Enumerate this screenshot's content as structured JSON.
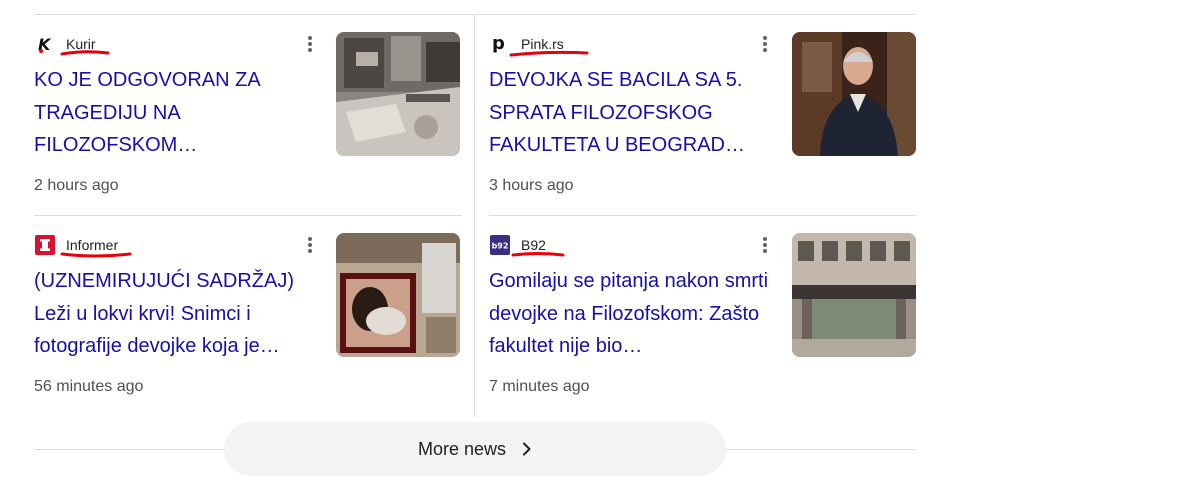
{
  "articles": [
    {
      "source": "Kurir",
      "favicon": "kurir-logo-icon",
      "headline": "KO JE ODGOVORAN ZA TRAGEDIJU NA FILOZOFSKOM…",
      "time": "2 hours ago",
      "thumbnail": "damaged-building-photo"
    },
    {
      "source": "Pink.rs",
      "favicon": "pink-logo-icon",
      "headline": "DEVOJKA SE BACILA SA 5. SPRATA FILOZOFSKOG FAKULTETA U BEOGRAD…",
      "time": "3 hours ago",
      "thumbnail": "man-portrait-photo"
    },
    {
      "source": "Informer",
      "favicon": "informer-logo-icon",
      "headline": "(UZNEMIRUJUĆI SADRŽAJ) Leži u lokvi krvi! Snimci i fotografije devojke koja je…",
      "time": "56 minutes ago",
      "thumbnail": "collage-photo"
    },
    {
      "source": "B92",
      "favicon": "b92-logo-icon",
      "favicon_text": "b92",
      "headline": "Gomilaju se pitanja nakon smrti devojke na Filozofskom: Zašto fakultet nije bio…",
      "time": "7 minutes ago",
      "thumbnail": "faculty-building-photo"
    }
  ],
  "more_news": {
    "label": "More news",
    "icon": "chevron-right-icon"
  },
  "colors": {
    "headline": "#1a0dab",
    "source": "#202124",
    "time": "#4d5156",
    "divider": "#dadce0",
    "annotation": "#e8000b",
    "button_bg": "#f1f3f4"
  }
}
